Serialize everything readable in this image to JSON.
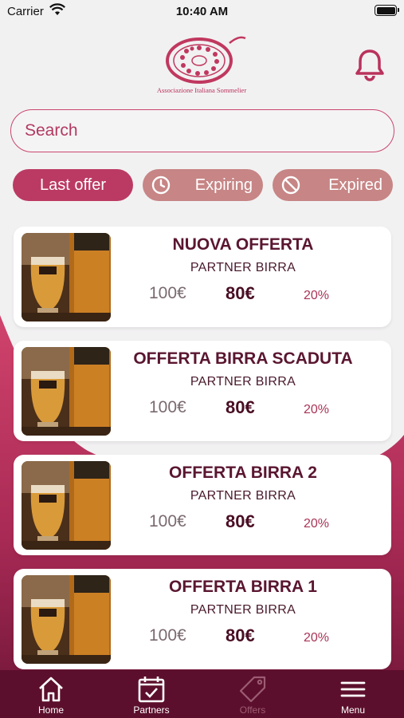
{
  "status_bar": {
    "carrier": "Carrier",
    "time": "10:40 AM"
  },
  "header": {
    "logo_text": "Associazione Italiana Sommelier",
    "logo_icon": "sommelier-logo",
    "notification_icon": "bell-icon"
  },
  "search": {
    "placeholder": "Search",
    "value": ""
  },
  "filters": [
    {
      "label": "Last offer",
      "active": true,
      "icon": ""
    },
    {
      "label": "Expiring",
      "active": false,
      "icon": "clock-icon"
    },
    {
      "label": "Expired",
      "active": false,
      "icon": "ban-icon"
    }
  ],
  "offers": [
    {
      "title": "NUOVA OFFERTA",
      "partner": "PARTNER BIRRA",
      "price_old": "100€",
      "price_new": "80€",
      "discount": "20%"
    },
    {
      "title": "OFFERTA BIRRA SCADUTA",
      "partner": "PARTNER BIRRA",
      "price_old": "100€",
      "price_new": "80€",
      "discount": "20%"
    },
    {
      "title": "OFFERTA BIRRA 2",
      "partner": "PARTNER BIRRA",
      "price_old": "100€",
      "price_new": "80€",
      "discount": "20%"
    },
    {
      "title": "OFFERTA BIRRA 1",
      "partner": "PARTNER BIRRA",
      "price_old": "100€",
      "price_new": "80€",
      "discount": "20%"
    }
  ],
  "nav": [
    {
      "label": "Home",
      "icon": "home-icon",
      "active": false
    },
    {
      "label": "Partners",
      "icon": "calendar-check-icon",
      "active": false
    },
    {
      "label": "Offers",
      "icon": "tag-icon",
      "active": true
    },
    {
      "label": "Menu",
      "icon": "hamburger-menu-icon",
      "active": false
    }
  ],
  "colors": {
    "brand": "#bb3a63",
    "brand_dark": "#5c0f2c",
    "inactive_tab": "#c78585",
    "background": "#f2f1f2"
  }
}
